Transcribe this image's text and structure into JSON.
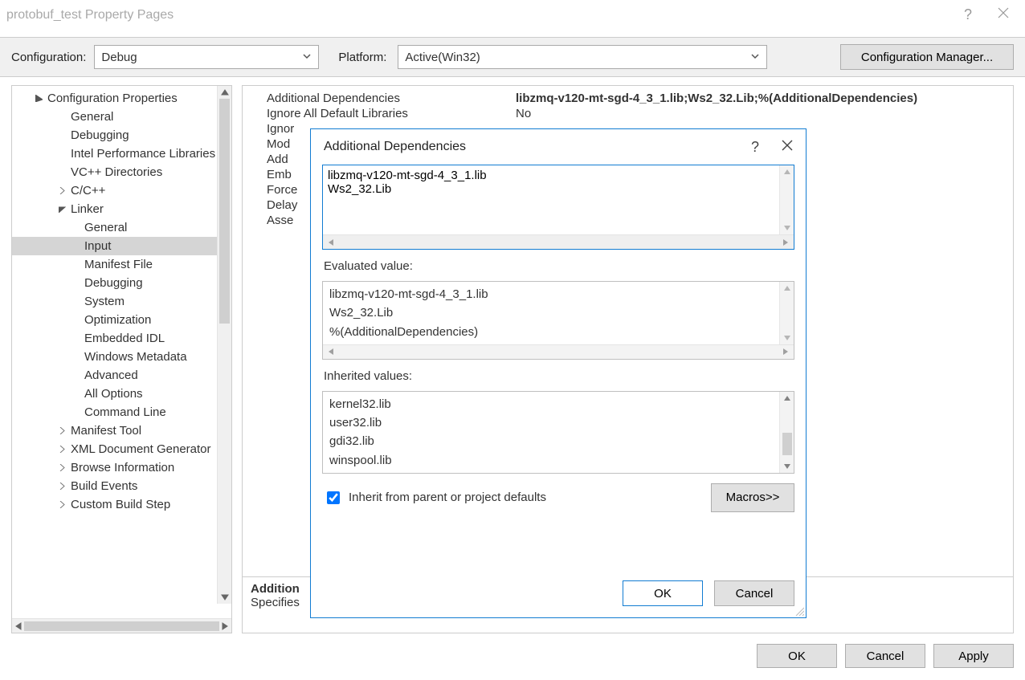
{
  "window": {
    "title": "protobuf_test Property Pages"
  },
  "config": {
    "config_label": "Configuration:",
    "config_value": "Debug",
    "platform_label": "Platform:",
    "platform_value": "Active(Win32)",
    "manager_button": "Configuration Manager..."
  },
  "tree": {
    "root": "Configuration Properties",
    "items": [
      {
        "label": "General",
        "indent": "ind2"
      },
      {
        "label": "Debugging",
        "indent": "ind2"
      },
      {
        "label": "Intel Performance Libraries",
        "indent": "ind2"
      },
      {
        "label": "VC++ Directories",
        "indent": "ind2"
      },
      {
        "label": "C/C++",
        "indent": "ind2",
        "expander": "collapsed"
      },
      {
        "label": "Linker",
        "indent": "ind2",
        "expander": "expanded"
      },
      {
        "label": "General",
        "indent": "ind3"
      },
      {
        "label": "Input",
        "indent": "ind3",
        "selected": true
      },
      {
        "label": "Manifest File",
        "indent": "ind3"
      },
      {
        "label": "Debugging",
        "indent": "ind3"
      },
      {
        "label": "System",
        "indent": "ind3"
      },
      {
        "label": "Optimization",
        "indent": "ind3"
      },
      {
        "label": "Embedded IDL",
        "indent": "ind3"
      },
      {
        "label": "Windows Metadata",
        "indent": "ind3"
      },
      {
        "label": "Advanced",
        "indent": "ind3"
      },
      {
        "label": "All Options",
        "indent": "ind3"
      },
      {
        "label": "Command Line",
        "indent": "ind3"
      },
      {
        "label": "Manifest Tool",
        "indent": "ind2",
        "expander": "collapsed"
      },
      {
        "label": "XML Document Generator",
        "indent": "ind2",
        "expander": "collapsed"
      },
      {
        "label": "Browse Information",
        "indent": "ind2",
        "expander": "collapsed"
      },
      {
        "label": "Build Events",
        "indent": "ind2",
        "expander": "collapsed"
      },
      {
        "label": "Custom Build Step",
        "indent": "ind2",
        "expander": "collapsed"
      }
    ]
  },
  "grid": {
    "rows": [
      {
        "name": "Additional Dependencies",
        "value": "libzmq-v120-mt-sgd-4_3_1.lib;Ws2_32.Lib;%(AdditionalDependencies)",
        "bold": true
      },
      {
        "name": "Ignore All Default Libraries",
        "value": "No"
      },
      {
        "name": "Ignor",
        "value": ""
      },
      {
        "name": "Mod",
        "value": ""
      },
      {
        "name": "Add",
        "value": ""
      },
      {
        "name": "Emb",
        "value": ""
      },
      {
        "name": "Force",
        "value": ""
      },
      {
        "name": "Delay",
        "value": ""
      },
      {
        "name": "Asse",
        "value": ""
      }
    ],
    "desc_title": "Addition",
    "desc_text": "Specifies"
  },
  "modal": {
    "title": "Additional Dependencies",
    "edit_value": "libzmq-v120-mt-sgd-4_3_1.lib\nWs2_32.Lib",
    "evaluated_label": "Evaluated value:",
    "evaluated_value": "libzmq-v120-mt-sgd-4_3_1.lib\nWs2_32.Lib\n%(AdditionalDependencies)",
    "inherited_label": "Inherited values:",
    "inherited_value": "kernel32.lib\nuser32.lib\ngdi32.lib\nwinspool.lib",
    "inherit_checkbox_label": "Inherit from parent or project defaults",
    "inherit_checked": true,
    "macros_button": "Macros>>",
    "ok": "OK",
    "cancel": "Cancel"
  },
  "footer": {
    "ok": "OK",
    "cancel": "Cancel",
    "apply": "Apply"
  }
}
